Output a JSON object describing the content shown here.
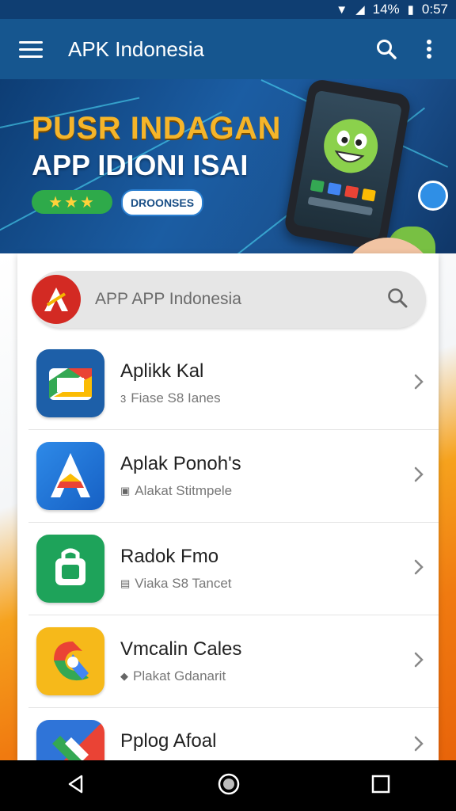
{
  "status_bar": {
    "battery": "14%",
    "time": "0:57"
  },
  "app_bar": {
    "title": "APK Indonesia"
  },
  "banner": {
    "headline": "PUSR INDAGAN",
    "subheadline": "APP IDIONI ISAI",
    "rating_stars": "★★★",
    "button_label": "DROONSES"
  },
  "search": {
    "placeholder": "APP APP Indonesia"
  },
  "apps": [
    {
      "name": "Aplikk Kal",
      "subtitle": "Fiase S8 Ianes",
      "sub_icon": "3"
    },
    {
      "name": "Aplak Ponoh's",
      "subtitle": "Alakat Stitmpele",
      "sub_icon": "▣"
    },
    {
      "name": "Radok Fmo",
      "subtitle": "Viaka S8 Tancet",
      "sub_icon": "▤"
    },
    {
      "name": "Vmcalin Cales",
      "subtitle": "Plakat Gdanarit",
      "sub_icon": "◆"
    },
    {
      "name": "Pplog Afoal",
      "subtitle": "",
      "sub_icon": ""
    }
  ],
  "colors": {
    "app_bar": "#16568f",
    "accent_orange": "#f07a10",
    "banner_gold": "#f5b52a"
  }
}
